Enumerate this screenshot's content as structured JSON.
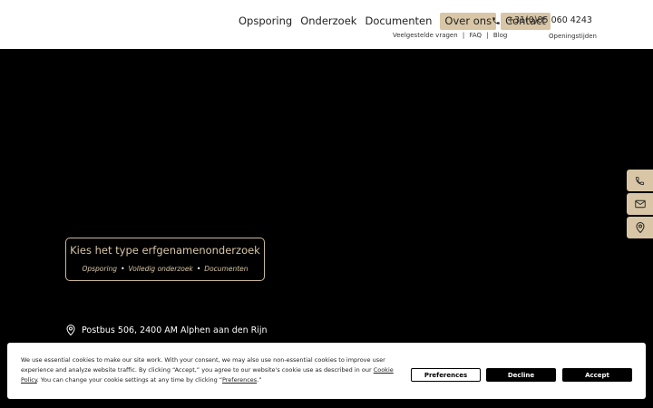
{
  "nav": {
    "items": [
      {
        "label": "Opsporing"
      },
      {
        "label": "Onderzoek"
      },
      {
        "label": "Documenten"
      },
      {
        "label": "Over ons"
      },
      {
        "label": "Contact"
      }
    ],
    "phone": "+31(0)85 060 4243",
    "sub_links": [
      "Veelgestelde vragen",
      "FAQ",
      "Blog"
    ],
    "sub_sep": "|",
    "hours": "Openingstijden"
  },
  "hero": {
    "title": "Kies het type erfgenamenonderzoek",
    "links": [
      "Opsporing",
      "Volledig onderzoek",
      "Documenten"
    ],
    "dot": "•",
    "address": "Postbus 506, 2400 AM Alphen aan den Rijn"
  },
  "side_buttons": [
    "phone-icon",
    "mail-icon",
    "location-pin-icon"
  ],
  "cookie": {
    "text_before": "We use essential cookies to make our site work. With your consent, we may also use non-essential cookies to improve user experience and analyze website traffic. By clicking “Accept,” you agree to our website's cookie use as described in our ",
    "policy_link": "Cookie Policy",
    "text_middle": ". You can change your cookie settings at any time by clicking “",
    "preferences_link": "Preferences",
    "text_end": ".”",
    "buttons": {
      "preferences": "Preferences",
      "decline": "Decline",
      "accept": "Accept"
    }
  },
  "colors": {
    "accent": "#d8c6a6",
    "background": "#000000",
    "header": "#ffffff"
  }
}
